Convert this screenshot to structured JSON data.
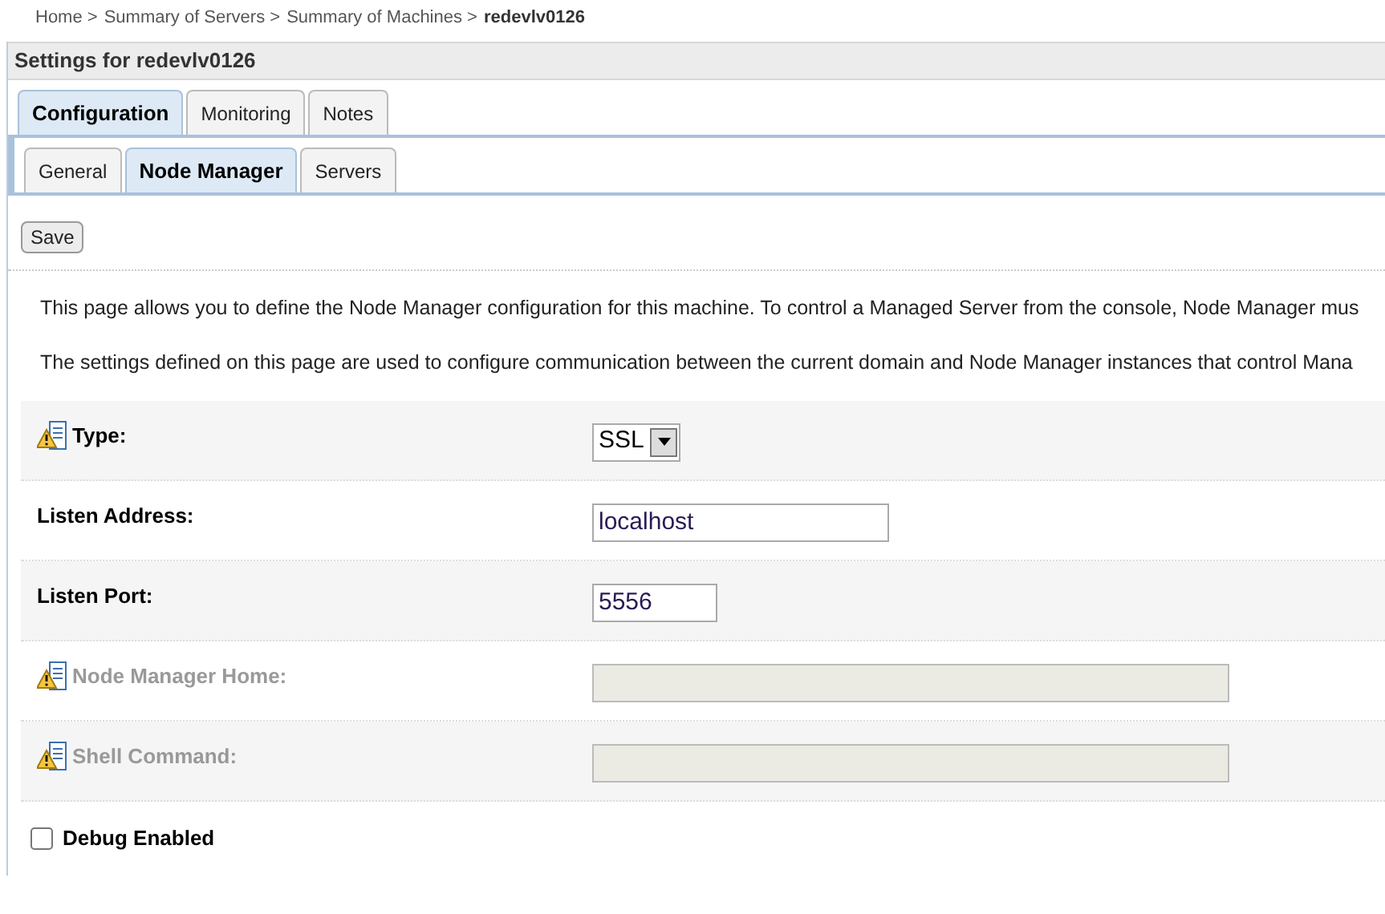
{
  "breadcrumb": {
    "links": [
      "Home >",
      "Summary of Servers >",
      "Summary of Machines >"
    ],
    "current": "redevlv0126"
  },
  "title": "Settings for redevlv0126",
  "tabs": [
    {
      "label": "Configuration",
      "selected": true
    },
    {
      "label": "Monitoring",
      "selected": false
    },
    {
      "label": "Notes",
      "selected": false
    }
  ],
  "subtabs": [
    {
      "label": "General",
      "selected": false
    },
    {
      "label": "Node Manager",
      "selected": true
    },
    {
      "label": "Servers",
      "selected": false
    }
  ],
  "save_button": "Save",
  "description": [
    "This page allows you to define the Node Manager configuration for this machine. To control a Managed Server from the console, Node Manager mus",
    "The settings defined on this page are used to configure communication between the current domain and Node Manager instances that control Mana"
  ],
  "fields": [
    {
      "kind": "select",
      "label": "Type:",
      "value": "SSL",
      "warning": true,
      "disabled": false
    },
    {
      "kind": "text",
      "label": "Listen Address:",
      "value": "localhost",
      "warning": false,
      "disabled": false
    },
    {
      "kind": "short",
      "label": "Listen Port:",
      "value": "5556",
      "warning": false,
      "disabled": false
    },
    {
      "kind": "text",
      "label": "Node Manager Home:",
      "warning": true,
      "disabled": true
    },
    {
      "kind": "text",
      "label": "Shell Command:",
      "warning": true,
      "disabled": true
    },
    {
      "kind": "checkbox",
      "label": "Debug Enabled",
      "checked": false,
      "disabled": false
    }
  ]
}
